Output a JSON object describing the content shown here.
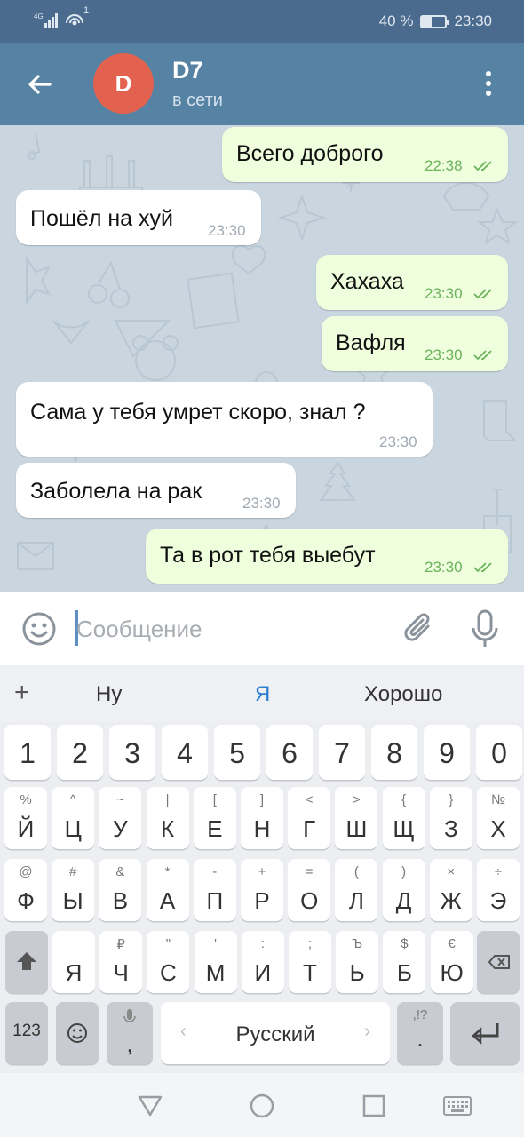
{
  "status_bar": {
    "network": "4G",
    "hotspot_count": "1",
    "battery_percent": "40 %",
    "battery_level": 0.4,
    "time": "23:30"
  },
  "header": {
    "avatar_letter": "D",
    "contact_name": "D7",
    "contact_status": "в сети"
  },
  "messages": [
    {
      "direction": "out",
      "text": "Всего доброго",
      "time": "22:38",
      "read": true
    },
    {
      "direction": "in",
      "text": "Пошёл на хуй",
      "time": "23:30"
    },
    {
      "direction": "out",
      "text": "Хахаха",
      "time": "23:30",
      "read": true
    },
    {
      "direction": "out",
      "text": "Вафля",
      "time": "23:30",
      "read": true
    },
    {
      "direction": "in",
      "text": "Сама у тебя умрет скоро, знал ?",
      "time": "23:30"
    },
    {
      "direction": "in",
      "text": "Заболела на рак",
      "time": "23:30"
    },
    {
      "direction": "out",
      "text": "Та в рот тебя выебут",
      "time": "23:30",
      "read": true
    }
  ],
  "input": {
    "placeholder": "Сообщение",
    "value": ""
  },
  "suggestions": {
    "plus": "+",
    "items": [
      "Ну",
      "Я",
      "Хорошо"
    ],
    "active_index": 1
  },
  "keyboard": {
    "number_row": [
      "1",
      "2",
      "3",
      "4",
      "5",
      "6",
      "7",
      "8",
      "9",
      "0"
    ],
    "row1": [
      {
        "main": "Й",
        "sub": "%"
      },
      {
        "main": "Ц",
        "sub": "^"
      },
      {
        "main": "У",
        "sub": "~"
      },
      {
        "main": "К",
        "sub": "|"
      },
      {
        "main": "Е",
        "sub": "["
      },
      {
        "main": "Н",
        "sub": "]"
      },
      {
        "main": "Г",
        "sub": "<"
      },
      {
        "main": "Ш",
        "sub": ">"
      },
      {
        "main": "Щ",
        "sub": "{"
      },
      {
        "main": "З",
        "sub": "}"
      },
      {
        "main": "Х",
        "sub": "№"
      }
    ],
    "row2": [
      {
        "main": "Ф",
        "sub": "@"
      },
      {
        "main": "Ы",
        "sub": "#"
      },
      {
        "main": "В",
        "sub": "&"
      },
      {
        "main": "А",
        "sub": "*"
      },
      {
        "main": "П",
        "sub": "-"
      },
      {
        "main": "Р",
        "sub": "+"
      },
      {
        "main": "О",
        "sub": "="
      },
      {
        "main": "Л",
        "sub": "("
      },
      {
        "main": "Д",
        "sub": ")"
      },
      {
        "main": "Ж",
        "sub": "×"
      },
      {
        "main": "Э",
        "sub": "÷"
      }
    ],
    "row3": [
      {
        "main": "Я",
        "sub": "_"
      },
      {
        "main": "Ч",
        "sub": "₽"
      },
      {
        "main": "С",
        "sub": "\""
      },
      {
        "main": "М",
        "sub": "'"
      },
      {
        "main": "И",
        "sub": ":"
      },
      {
        "main": "Т",
        "sub": ";"
      },
      {
        "main": "Ь",
        "sub": "Ъ"
      },
      {
        "main": "Б",
        "sub": "$"
      },
      {
        "main": "Ю",
        "sub": "€"
      }
    ],
    "numbers_toggle": "123",
    "comma": ",",
    "space_label": "Русский",
    "period": ".",
    "period_sub": ",!?"
  }
}
